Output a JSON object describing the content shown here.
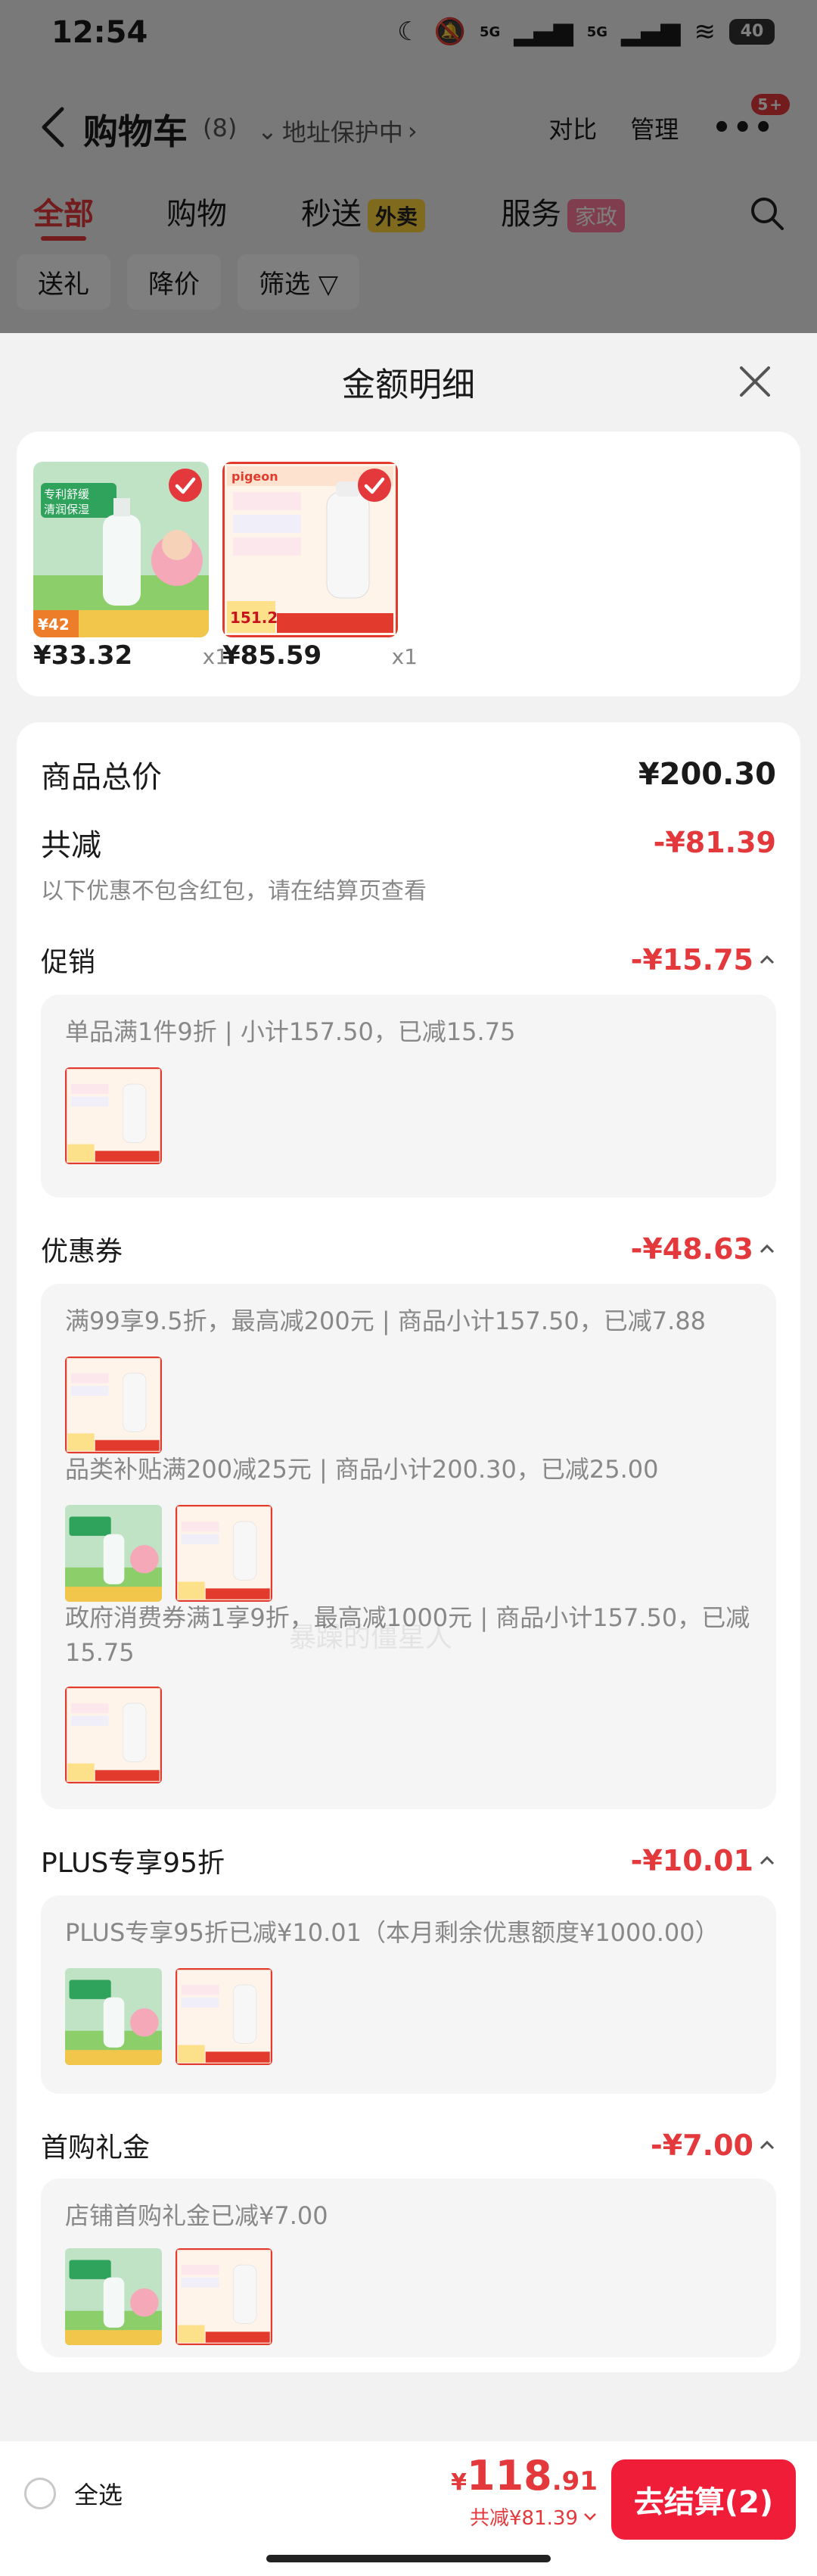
{
  "status_bar": {
    "time": "12:54",
    "net1": "5G",
    "net2": "5G",
    "battery": "40"
  },
  "nav": {
    "title": "购物车",
    "count": "(8)",
    "address": "地址保护中",
    "compare": "对比",
    "manage": "管理",
    "badge": "5+"
  },
  "tabs": [
    {
      "label": "全部"
    },
    {
      "label": "购物"
    },
    {
      "label": "秒送",
      "tag": "外卖"
    },
    {
      "label": "服务",
      "tag": "家政"
    }
  ],
  "filters": [
    "送礼",
    "降价",
    "筛选"
  ],
  "sheet": {
    "title": "金额明细",
    "products": [
      {
        "price": "¥33.32",
        "qty": "x1",
        "thumb_tag": "专利舒缓清润保湿",
        "thumb_price": "42"
      },
      {
        "price": "¥85.59",
        "qty": "x1",
        "thumb_brand": "pigeon",
        "thumb_price": "151.2"
      }
    ],
    "summary": {
      "total_label": "商品总价",
      "total_value": "¥200.30",
      "discount_label": "共减",
      "discount_value": "-¥81.39",
      "note": "以下优惠不包含红包，请在结算页查看"
    },
    "sections": {
      "promo": {
        "label": "促销",
        "value": "-¥15.75",
        "text": "单品满1件9折 | 小计157.50，已减15.75"
      },
      "coupon": {
        "label": "优惠券",
        "value": "-¥48.63",
        "lines": [
          "满99享9.5折，最高减200元 | 商品小计157.50，已减7.88",
          "品类补贴满200减25元 | 商品小计200.30，已减25.00",
          "政府消费券满1享9折，最高减1000元 | 商品小计157.50，已减15.75"
        ]
      },
      "plus": {
        "label": "PLUS专享95折",
        "value": "-¥10.01",
        "text": "PLUS专享95折已减¥10.01（本月剩余优惠额度¥1000.00）"
      },
      "first": {
        "label": "首购礼金",
        "value": "-¥7.00",
        "text": "店铺首购礼金已减¥7.00"
      }
    },
    "watermark": "暴躁的僵星人"
  },
  "bottom": {
    "select_all": "全选",
    "yen": "¥",
    "total_int": "118",
    "total_dec": ".91",
    "saved": "共减¥81.39",
    "checkout": "去结算(2)"
  },
  "colors": {
    "accent": "#e4393c",
    "checkout": "#f01d38"
  }
}
